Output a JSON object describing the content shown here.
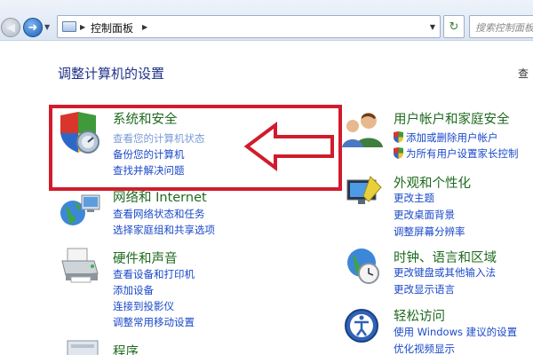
{
  "address_bar": {
    "path_label": "控制面板",
    "search_placeholder": "搜索控制面板"
  },
  "page": {
    "title": "调整计算机的设置",
    "view_by_partial": "查"
  },
  "categories": {
    "system_security": {
      "title": "系统和安全",
      "links": [
        "查看您的计算机状态",
        "备份您的计算机",
        "查找并解决问题"
      ]
    },
    "network": {
      "title": "网络和 Internet",
      "links": [
        "查看网络状态和任务",
        "选择家庭组和共享选项"
      ]
    },
    "hardware": {
      "title": "硬件和声音",
      "links": [
        "查看设备和打印机",
        "添加设备",
        "连接到投影仪",
        "调整常用移动设置"
      ]
    },
    "programs": {
      "title": "程序"
    },
    "user_accounts": {
      "title": "用户帐户和家庭安全",
      "links": [
        "添加或删除用户帐户",
        "为所有用户设置家长控制"
      ]
    },
    "appearance": {
      "title": "外观和个性化",
      "links": [
        "更改主题",
        "更改桌面背景",
        "调整屏幕分辨率"
      ]
    },
    "clock": {
      "title": "时钟、语言和区域",
      "links": [
        "更改键盘或其他输入法",
        "更改显示语言"
      ]
    },
    "ease": {
      "title": "轻松访问",
      "links": [
        "使用 Windows 建议的设置",
        "优化视频显示"
      ]
    }
  },
  "colors": {
    "highlight": "#d01c2c",
    "category_title": "#1f6a1f",
    "link": "#1a49c9",
    "page_title": "#1e3287"
  }
}
